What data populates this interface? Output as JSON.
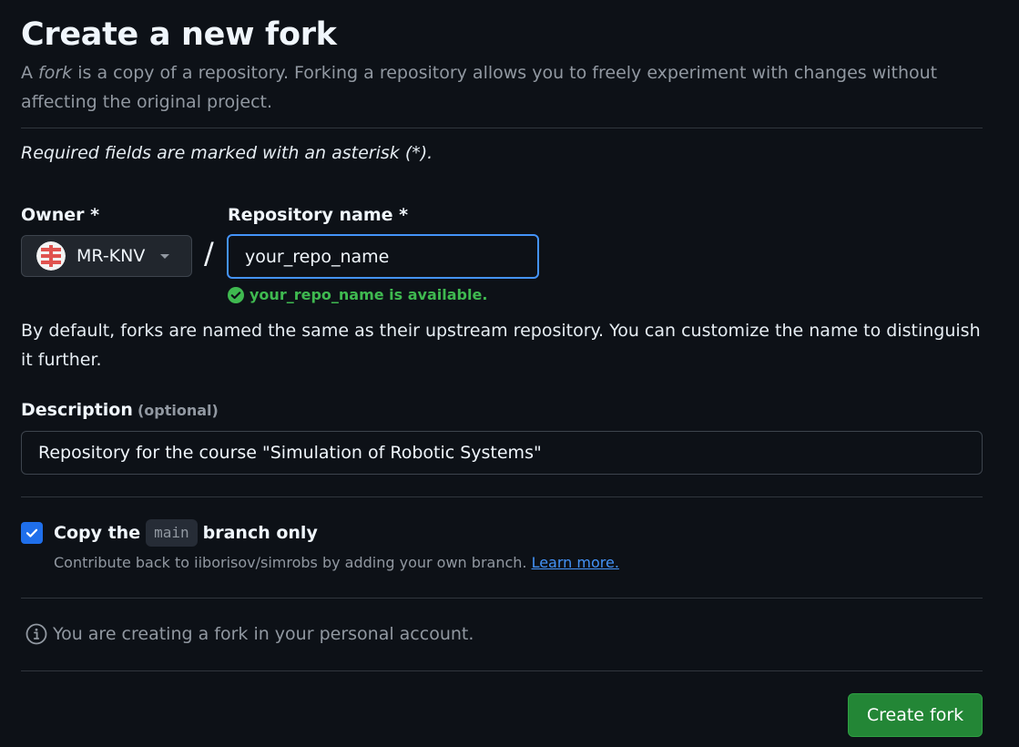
{
  "header": {
    "title": "Create a new fork",
    "intro_prefix": "A ",
    "intro_em": "fork",
    "intro_suffix": " is a copy of a repository. Forking a repository allows you to freely experiment with changes without affecting the original project."
  },
  "form": {
    "required_note": "Required fields are marked with an asterisk (*).",
    "owner": {
      "label": "Owner *",
      "value": "MR-KNV",
      "avatar_icon": "owner-avatar-icon",
      "caret_icon": "caret-down-icon"
    },
    "separator": "/",
    "repo_name": {
      "label": "Repository name *",
      "value": "your_repo_name",
      "availability": "your_repo_name is available.",
      "status_color": "#3fb950"
    },
    "name_help": "By default, forks are named the same as their upstream repository. You can customize the name to distinguish it further.",
    "description": {
      "label": "Description",
      "optional": "(optional)",
      "value": "Repository for the course \"Simulation of Robotic Systems\""
    },
    "copy_branch": {
      "checked": true,
      "label_prefix": "Copy the",
      "branch": "main",
      "label_suffix": "branch only",
      "help_prefix": "Contribute back to iiborisov/simrobs by adding your own branch.",
      "learn_more": "Learn more."
    },
    "info_text": "You are creating a fork in your personal account.",
    "submit_label": "Create fork"
  },
  "colors": {
    "background": "#0d1117",
    "accent": "#4493f8",
    "primary_button": "#238636",
    "checkbox": "#1f6feb"
  }
}
